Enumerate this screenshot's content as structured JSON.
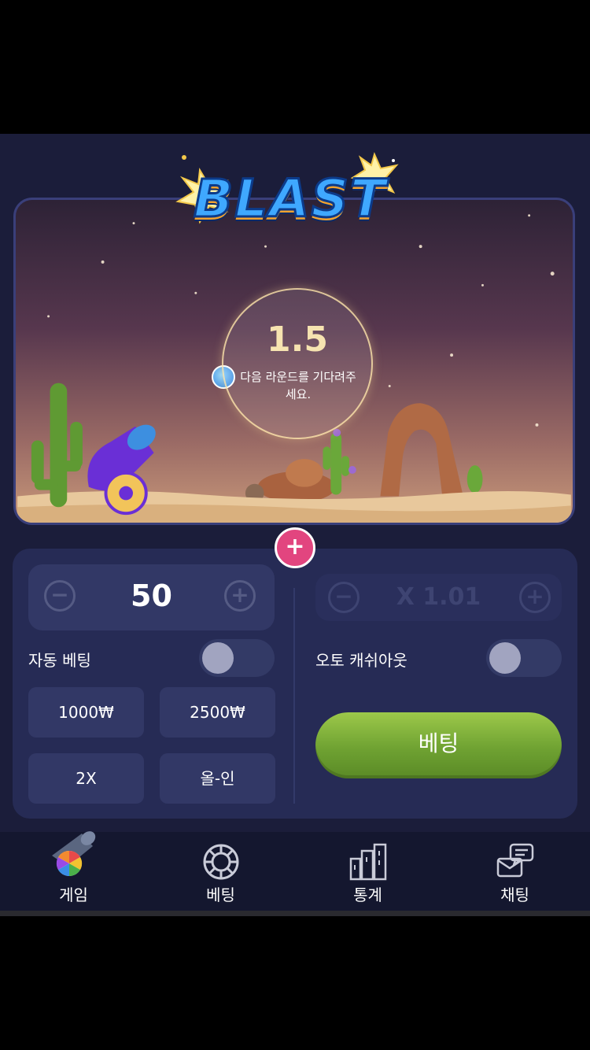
{
  "game": {
    "logo_text": "BLAST",
    "countdown_value": "1.5",
    "countdown_message": "다음 라운드를 기다려주세요."
  },
  "controls": {
    "add_panel_symbol": "+",
    "bet_amount": {
      "minus": "−",
      "value": "50",
      "plus": "+"
    },
    "cashout_multiplier": {
      "minus": "−",
      "value": "X 1.01",
      "plus": "+"
    },
    "auto_bet_label": "자동 베팅",
    "auto_cashout_label": "오토 캐쉬아웃",
    "auto_bet_enabled": false,
    "auto_cashout_enabled": false,
    "chips": [
      "1000₩",
      "2500₩",
      "2X",
      "올-인"
    ],
    "bet_button_label": "베팅"
  },
  "nav": {
    "items": [
      {
        "label": "게임",
        "icon": "cannon-icon"
      },
      {
        "label": "베팅",
        "icon": "chip-icon"
      },
      {
        "label": "통계",
        "icon": "stats-building-icon"
      },
      {
        "label": "채팅",
        "icon": "chat-icon"
      }
    ]
  },
  "colors": {
    "background": "#1b1d3a",
    "panel": "#262b55",
    "accent_pink": "#e2457f",
    "bet_green": "#6fa232"
  }
}
